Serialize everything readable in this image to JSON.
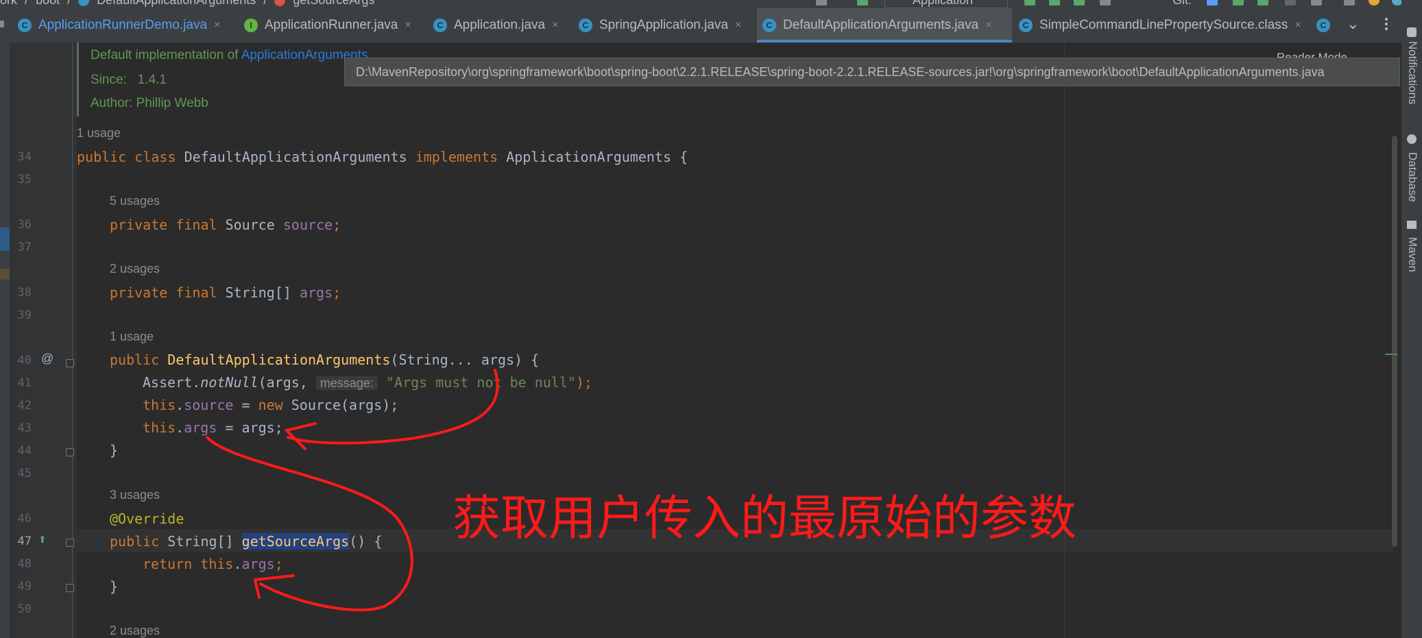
{
  "breadcrumb": [
    "ork",
    "/",
    "boot",
    "/",
    "DefaultApplicationArguments",
    "/",
    "getSourceArgs"
  ],
  "toolbar": {
    "run_config": "Application",
    "git_label": "Git:"
  },
  "tabs": [
    {
      "label": "ApplicationRunnerDemo.java",
      "icon": "class-icon",
      "color": "#589df6"
    },
    {
      "label": "ApplicationRunner.java",
      "icon": "interface-icon"
    },
    {
      "label": "Application.java",
      "icon": "class-icon"
    },
    {
      "label": "SpringApplication.java",
      "icon": "class-icon"
    },
    {
      "label": "DefaultApplicationArguments.java",
      "icon": "class-icon",
      "active": true
    },
    {
      "label": "SimpleCommandLinePropertySource.class",
      "icon": "class-icon"
    }
  ],
  "tab_icon_letters": {
    "class": "C",
    "interface": "I"
  },
  "tab_close_glyph": "×",
  "tab_more_glyph": "⌄",
  "doc": {
    "line1_prefix": "Default implementation of ",
    "line1_link": "ApplicationArguments",
    "since_label": "Since:",
    "since_value": "1.4.1",
    "author_label": "Author:",
    "author_value": "Phillip Webb"
  },
  "tooltip": "D:\\MavenRepository\\org\\springframework\\boot\\spring-boot\\2.2.1.RELEASE\\spring-boot-2.2.1.RELEASE-sources.jar!\\org\\springframework\\boot\\DefaultApplicationArguments.java",
  "reader_mode": "Reader Mode",
  "usages": {
    "class": "1 usage",
    "source": "5 usages",
    "args": "2 usages",
    "ctor": "1 usage",
    "getSourceArgs": "3 usages",
    "next": "2 usages"
  },
  "line_numbers": [
    "34",
    "35",
    "36",
    "37",
    "38",
    "39",
    "40",
    "41",
    "42",
    "43",
    "44",
    "45",
    "46",
    "47",
    "48",
    "49",
    "50"
  ],
  "code": {
    "l34": {
      "kw1": "public",
      "kw2": "class",
      "name": "DefaultApplicationArguments",
      "kw3": "implements",
      "iface": "ApplicationArguments",
      "brace": "{"
    },
    "l36": {
      "kw": "private final",
      "type": "Source",
      "field": "source",
      "end": ";"
    },
    "l38": {
      "kw": "private final",
      "type": "String[]",
      "field": "args",
      "end": ";"
    },
    "l40": {
      "kw": "public",
      "name": "DefaultApplicationArguments",
      "params": "(String... args) {"
    },
    "l41": {
      "obj": "Assert.",
      "method": "notNull",
      "open": "(args, ",
      "hint": "message:",
      "str": "\"Args must not be null\"",
      "close": ");"
    },
    "l42": {
      "this": "this",
      "dot": ".",
      "field": "source",
      "eq": " = ",
      "new": "new",
      "rest": " Source(args);"
    },
    "l43": {
      "this": "this",
      "dot": ".",
      "field": "args",
      "rest": " = args;"
    },
    "l44": "}",
    "l46": "@Override",
    "l47": {
      "kw": "public",
      "type": " String[] ",
      "name": "getSourceArgs",
      "rest": "() {"
    },
    "l48": {
      "kw": "return",
      "this": " this",
      "dot": ".",
      "field": "args",
      "end": ";"
    },
    "l49": "}"
  },
  "gutter_marks": {
    "at": "@",
    "impl": "⬆"
  },
  "side_tools": [
    "Notifications",
    "Database",
    "Maven"
  ],
  "annotation": "获取用户传入的最原始的参数",
  "colors": {
    "keyword": "#cc7832",
    "field": "#9876aa",
    "method": "#ffc66d",
    "string": "#6a8759",
    "annotation_red": "#ff1a1a"
  }
}
